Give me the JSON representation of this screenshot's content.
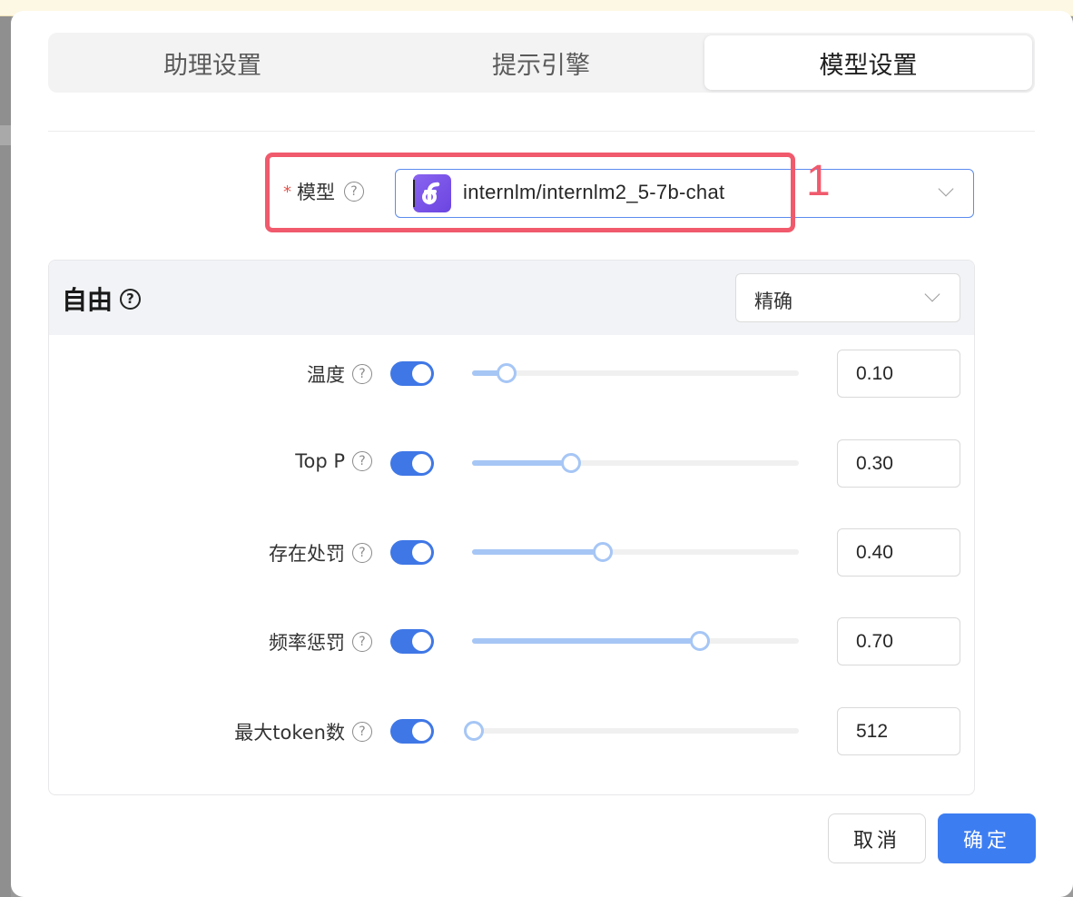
{
  "tabs": [
    {
      "label": "助理设置",
      "active": false
    },
    {
      "label": "提示引擎",
      "active": false
    },
    {
      "label": "模型设置",
      "active": true
    }
  ],
  "model": {
    "required_mark": "*",
    "label": "模型",
    "help_icon": "?",
    "value": "internlm/internlm2_5-7b-chat",
    "logo_icon": "model-provider-logo"
  },
  "annotation": {
    "number": "1",
    "color": "#f05a6c"
  },
  "params_panel": {
    "title": "自由",
    "help_icon": "?",
    "preset": "精确",
    "rows": [
      {
        "label": "温度",
        "enabled": true,
        "value": "0.10",
        "fraction": 0.1
      },
      {
        "label": "Top P",
        "enabled": true,
        "value": "0.30",
        "fraction": 0.3
      },
      {
        "label": "存在处罚",
        "enabled": true,
        "value": "0.40",
        "fraction": 0.4
      },
      {
        "label": "频率惩罚",
        "enabled": true,
        "value": "0.70",
        "fraction": 0.7
      },
      {
        "label": "最大token数",
        "enabled": true,
        "value": "512",
        "fraction": 0.0
      }
    ]
  },
  "footer": {
    "cancel_label": "取消",
    "ok_label": "确定"
  },
  "colors": {
    "accent": "#3d7df2",
    "toggle_on": "#3f77e6",
    "slider_fill": "#a6c6f5"
  }
}
